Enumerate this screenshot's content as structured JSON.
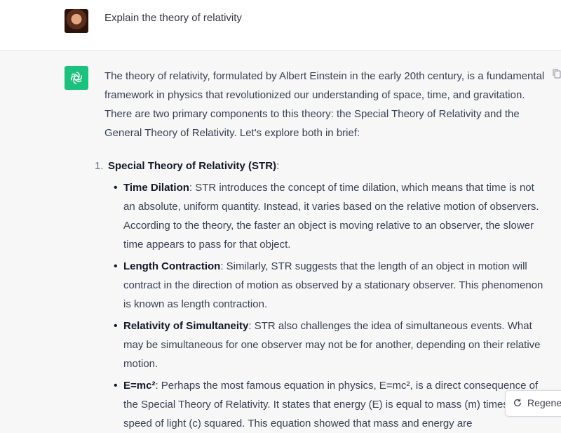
{
  "user_message": {
    "text": "Explain the theory of relativity",
    "avatar_icon": "user-avatar-photo"
  },
  "assistant_message": {
    "logo_icon": "openai-logo-icon",
    "intro": "The theory of relativity, formulated by Albert Einstein in the early 20th century, is a fundamental framework in physics that revolutionized our understanding of space, time, and gravitation. There are two primary components to this theory: the Special Theory of Relativity and the General Theory of Relativity. Let's explore both in brief:",
    "list": [
      {
        "marker": "1.",
        "title": "Special Theory of Relativity (STR)",
        "suffix": ":",
        "bullets": [
          {
            "title": "Time Dilation",
            "text": ": STR introduces the concept of time dilation, which means that time is not an absolute, uniform quantity. Instead, it varies based on the relative motion of observers. According to the theory, the faster an object is moving relative to an observer, the slower time appears to pass for that object."
          },
          {
            "title": "Length Contraction",
            "text": ": Similarly, STR suggests that the length of an object in motion will contract in the direction of motion as observed by a stationary observer. This phenomenon is known as length contraction."
          },
          {
            "title": "Relativity of Simultaneity",
            "text": ": STR also challenges the idea of simultaneous events. What may be simultaneous for one observer may not be for another, depending on their relative motion."
          },
          {
            "title": "E=mc²",
            "text": ": Perhaps the most famous equation in physics, E=mc², is a direct consequence of the Special Theory of Relativity. It states that energy (E) is equal to mass (m) times the speed of light (c) squared. This equation showed that mass and energy are"
          }
        ]
      }
    ]
  },
  "regenerate_button": {
    "label": "Regener",
    "icon": "refresh-icon"
  },
  "colors": {
    "accent": "#19c37d",
    "assistant_bg": "#f7f7f8",
    "user_bg": "#ffffff"
  }
}
